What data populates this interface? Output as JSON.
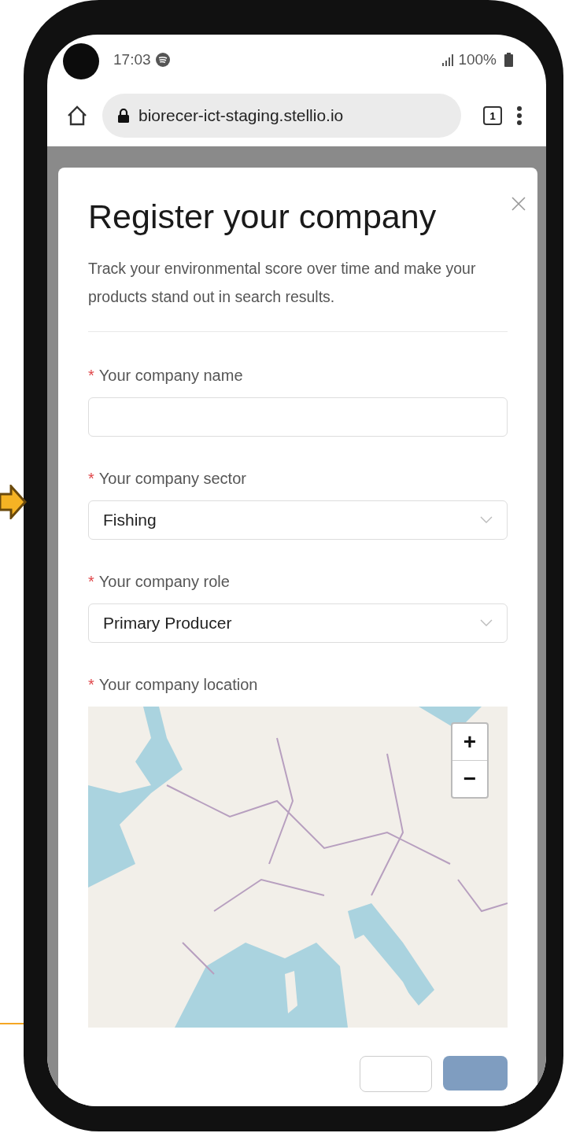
{
  "status_bar": {
    "time": "17:03",
    "battery": "100%"
  },
  "browser": {
    "url": "biorecer-ict-staging.stellio.io",
    "tab_count": "1"
  },
  "dialog": {
    "title": "Register your company",
    "description": "Track your environmental score over time and make your products stand out in search results.",
    "fields": [
      {
        "kind": "text",
        "required_mark": "*",
        "label": "Your company name"
      },
      {
        "kind": "select",
        "required_mark": "*",
        "label": "Your company sector",
        "value": "Fishing"
      },
      {
        "kind": "select",
        "required_mark": "*",
        "label": "Your company role",
        "value": "Primary Producer"
      },
      {
        "kind": "map",
        "required_mark": "*",
        "label": "Your company location",
        "zoom_in": "+",
        "zoom_out": "−"
      }
    ]
  }
}
